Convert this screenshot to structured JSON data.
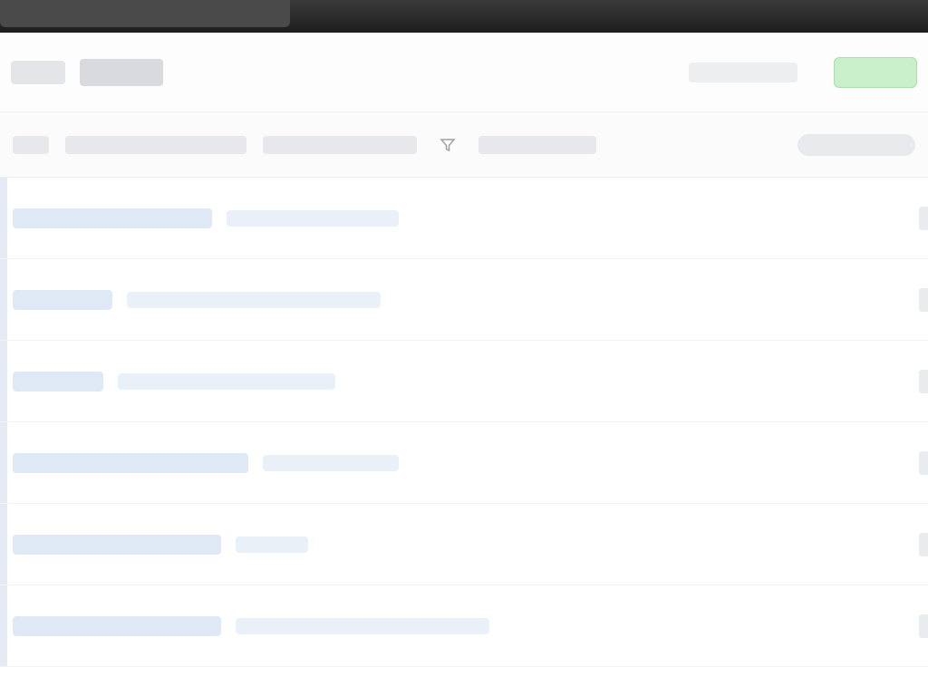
{
  "browser": {
    "tab_title": ""
  },
  "header": {
    "logo_text": "",
    "link_label": "",
    "action_button_label": "",
    "action_button_color": "#22863a"
  },
  "toolbar": {
    "items": [
      {
        "label": ""
      },
      {
        "label": ""
      },
      {
        "label": ""
      }
    ],
    "filter_icon": "filter-icon",
    "right_control_label": ""
  },
  "list": {
    "rows": [
      {
        "title": "",
        "subtitle": ""
      },
      {
        "title": "",
        "subtitle": ""
      },
      {
        "title": "",
        "subtitle": ""
      },
      {
        "title": "",
        "subtitle": ""
      },
      {
        "title": "",
        "subtitle": ""
      },
      {
        "title": "",
        "subtitle": ""
      }
    ]
  },
  "colors": {
    "link": "#0366d6",
    "accent_green": "#c9efcb",
    "row_tint": "#dfe9f6"
  }
}
